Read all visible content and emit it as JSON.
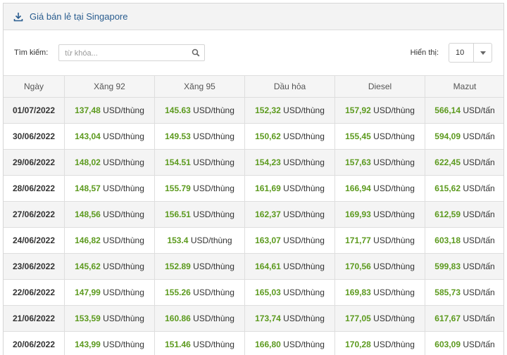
{
  "panel": {
    "title": "Giá bán lẻ tại Singapore",
    "icon": "download-icon"
  },
  "toolbar": {
    "search_label": "Tìm kiếm:",
    "search_placeholder": "từ khóa...",
    "length_label": "Hiển thị:",
    "length_value": "10"
  },
  "table": {
    "headers": [
      "Ngày",
      "Xăng 92",
      "Xăng 95",
      "Dầu hỏa",
      "Diesel",
      "Mazut"
    ],
    "rows": [
      [
        "01/07/2022",
        [
          "137,48",
          "USD/thùng"
        ],
        [
          "145.63",
          "USD/thùng"
        ],
        [
          "152,32",
          "USD/thùng"
        ],
        [
          "157,92",
          "USD/thùng"
        ],
        [
          "566,14",
          "USD/tấn"
        ]
      ],
      [
        "30/06/2022",
        [
          "143,04",
          "USD/thùng"
        ],
        [
          "149.53",
          "USD/thùng"
        ],
        [
          "150,62",
          "USD/thùng"
        ],
        [
          "155,45",
          "USD/thùng"
        ],
        [
          "594,09",
          "USD/tấn"
        ]
      ],
      [
        "29/06/2022",
        [
          "148,02",
          "USD/thùng"
        ],
        [
          "154.51",
          "USD/thùng"
        ],
        [
          "154,23",
          "USD/thùng"
        ],
        [
          "157,63",
          "USD/thùng"
        ],
        [
          "622,45",
          "USD/tấn"
        ]
      ],
      [
        "28/06/2022",
        [
          "148,57",
          "USD/thùng"
        ],
        [
          "155.79",
          "USD/thùng"
        ],
        [
          "161,69",
          "USD/thùng"
        ],
        [
          "166,94",
          "USD/thùng"
        ],
        [
          "615,62",
          "USD/tấn"
        ]
      ],
      [
        "27/06/2022",
        [
          "148,56",
          "USD/thùng"
        ],
        [
          "156.51",
          "USD/thùng"
        ],
        [
          "162,37",
          "USD/thùng"
        ],
        [
          "169,93",
          "USD/thùng"
        ],
        [
          "612,59",
          "USD/tấn"
        ]
      ],
      [
        "24/06/2022",
        [
          "146,82",
          "USD/thùng"
        ],
        [
          "153.4",
          "USD/thùng"
        ],
        [
          "163,07",
          "USD/thùng"
        ],
        [
          "171,77",
          "USD/thùng"
        ],
        [
          "603,18",
          "USD/tấn"
        ]
      ],
      [
        "23/06/2022",
        [
          "145,62",
          "USD/thùng"
        ],
        [
          "152.89",
          "USD/thùng"
        ],
        [
          "164,61",
          "USD/thùng"
        ],
        [
          "170,56",
          "USD/thùng"
        ],
        [
          "599,83",
          "USD/tấn"
        ]
      ],
      [
        "22/06/2022",
        [
          "147,99",
          "USD/thùng"
        ],
        [
          "155.26",
          "USD/thùng"
        ],
        [
          "165,03",
          "USD/thùng"
        ],
        [
          "169,83",
          "USD/thùng"
        ],
        [
          "585,73",
          "USD/tấn"
        ]
      ],
      [
        "21/06/2022",
        [
          "153,59",
          "USD/thùng"
        ],
        [
          "160.86",
          "USD/thùng"
        ],
        [
          "173,74",
          "USD/thùng"
        ],
        [
          "177,05",
          "USD/thùng"
        ],
        [
          "617,67",
          "USD/tấn"
        ]
      ],
      [
        "20/06/2022",
        [
          "143,99",
          "USD/thùng"
        ],
        [
          "151.46",
          "USD/thùng"
        ],
        [
          "166,80",
          "USD/thùng"
        ],
        [
          "170,28",
          "USD/thùng"
        ],
        [
          "603,09",
          "USD/tấn"
        ]
      ]
    ]
  },
  "colors": {
    "value_green": "#5c9a1e",
    "title_blue": "#2a5d8f",
    "stripe": "#f4f4f4"
  }
}
